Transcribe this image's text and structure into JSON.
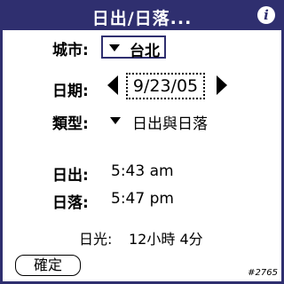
{
  "titlebar": {
    "title": "日出/日落...",
    "info_icon": "info-icon"
  },
  "city": {
    "label": "城市:",
    "value": "台北"
  },
  "date": {
    "label": "日期:",
    "value": "9/23/05"
  },
  "type": {
    "label": "類型:",
    "value": "日出與日落"
  },
  "results": {
    "sunrise_label": "日出:",
    "sunrise_value": "5:43 am",
    "sunset_label": "日落:",
    "sunset_value": "5:47 pm",
    "daylight_label": "日光:",
    "daylight_value": "12小時 4分"
  },
  "buttons": {
    "ok": "確定"
  },
  "watermark": "#2765",
  "colors": {
    "accent": "#2f2f6f"
  }
}
